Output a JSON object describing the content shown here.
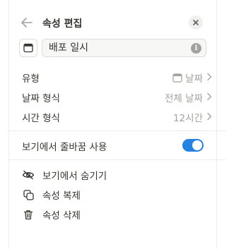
{
  "header": {
    "title": "속성 편집"
  },
  "name_field": {
    "value": "배포 일시"
  },
  "properties": {
    "type": {
      "label": "유형",
      "value": "날짜"
    },
    "date_format": {
      "label": "날짜 형식",
      "value": "전체 날짜"
    },
    "time_format": {
      "label": "시간 형식",
      "value": "12시간"
    }
  },
  "wrap_toggle": {
    "label": "보기에서 줄바꿈 사용",
    "enabled": true
  },
  "actions": {
    "hide": {
      "label": "보기에서 숨기기",
      "icon": "eye-slash-icon"
    },
    "duplicate": {
      "label": "속성 복제",
      "icon": "duplicate-icon"
    },
    "delete": {
      "label": "속성 삭제",
      "icon": "trash-icon"
    }
  },
  "colors": {
    "accent": "#2383e2",
    "text": "#37352f",
    "muted": "#a3a29e"
  }
}
